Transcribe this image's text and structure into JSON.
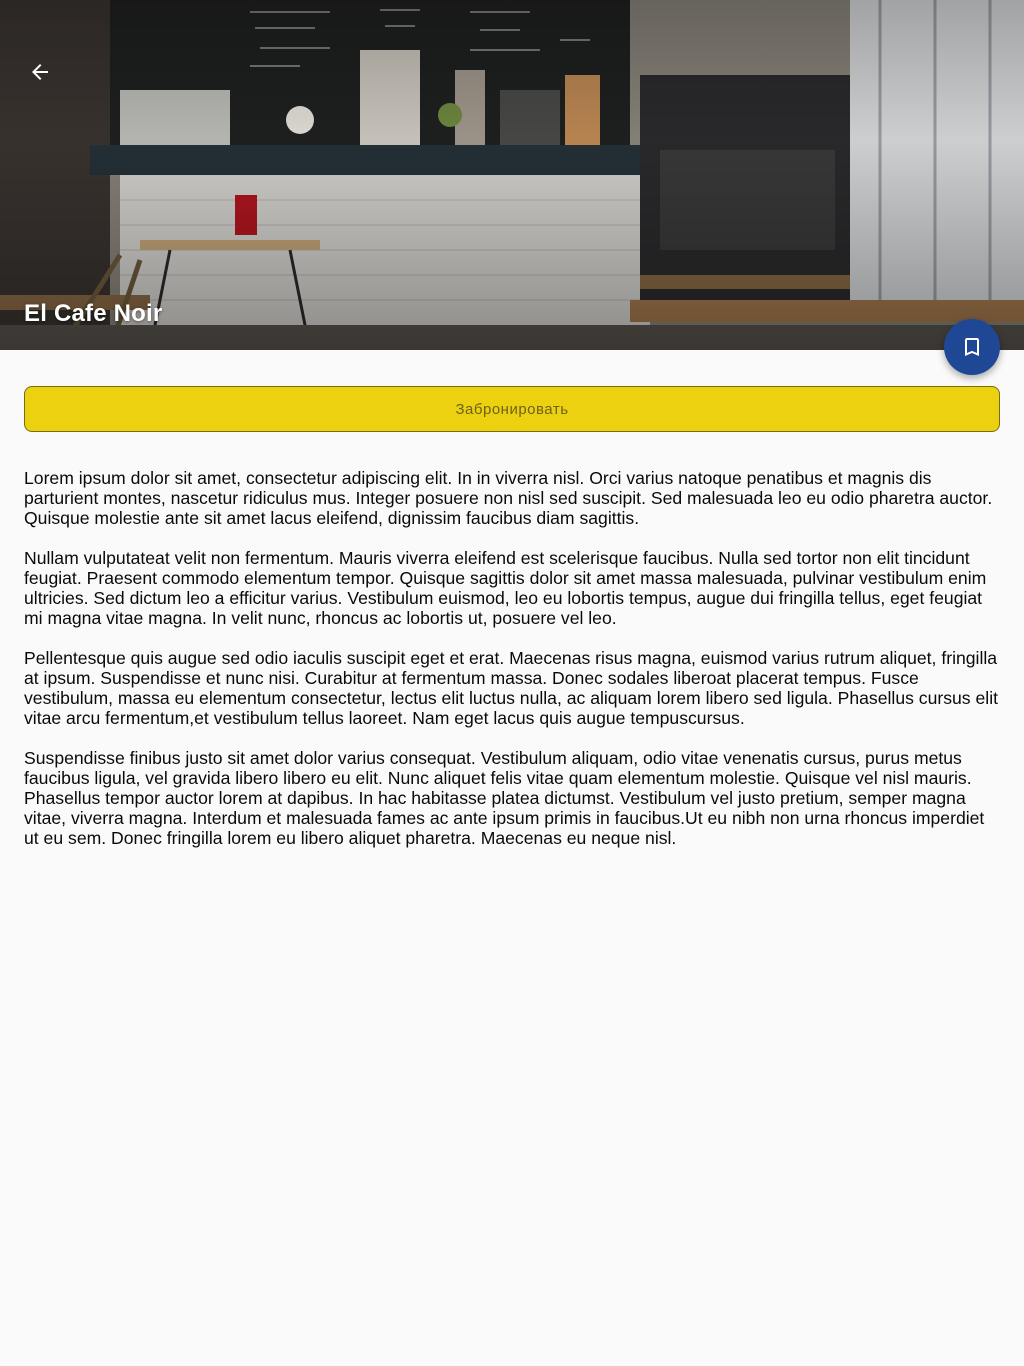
{
  "hero": {
    "title": "El Cafe Noir",
    "back_icon": "arrow-back-icon",
    "bookmark_icon": "bookmark-icon"
  },
  "actions": {
    "book_label": "Забронировать"
  },
  "description": {
    "paragraphs": [
      "Lorem ipsum dolor sit amet, consectetur adipiscing elit. In in viverra nisl. Orci varius natoque penatibus et magnis dis parturient montes, nascetur ridiculus mus. Integer posuere non nisl sed suscipit. Sed malesuada leo eu odio pharetra auctor. Quisque molestie ante sit amet lacus eleifend, dignissim faucibus diam sagittis.",
      "Nullam vulputateat velit non fermentum. Mauris viverra eleifend est scelerisque faucibus. Nulla sed tortor non elit tincidunt feugiat. Praesent commodo elementum tempor. Quisque sagittis dolor sit amet massa malesuada, pulvinar vestibulum enim ultricies. Sed dictum leo a efficitur varius. Vestibulum euismod, leo eu lobortis tempus, augue dui fringilla tellus, eget feugiat mi magna vitae magna. In velit nunc, rhoncus ac lobortis ut, posuere vel leo.",
      "Pellentesque quis augue sed odio iaculis suscipit eget et erat. Maecenas risus magna, euismod varius rutrum aliquet, fringilla at ipsum. Suspendisse et nunc nisi. Curabitur at fermentum massa. Donec sodales liberoat placerat tempus. Fusce vestibulum, massa eu elementum consectetur, lectus elit luctus nulla, ac aliquam lorem libero sed ligula. Phasellus cursus elit vitae arcu fermentum,et vestibulum tellus laoreet. Nam eget lacus quis augue tempuscursus.",
      "Suspendisse finibus justo sit amet dolor varius consequat. Vestibulum aliquam, odio vitae venenatis cursus, purus metus faucibus ligula, vel gravida libero libero eu elit. Nunc aliquet felis vitae quam elementum molestie. Quisque vel nisl mauris. Phasellus tempor auctor lorem at dapibus. In hac habitasse platea dictumst. Vestibulum vel justo pretium, semper magna vitae, viverra magna. Interdum et malesuada fames ac ante ipsum primis in faucibus.Ut eu nibh non urna rhoncus imperdiet ut eu sem. Donec fringilla lorem eu libero aliquet pharetra. Maecenas eu neque nisl."
    ]
  },
  "colors": {
    "book_button": "#ebd10f",
    "bookmark_fab": "#1e4796",
    "background": "#fafafa"
  }
}
